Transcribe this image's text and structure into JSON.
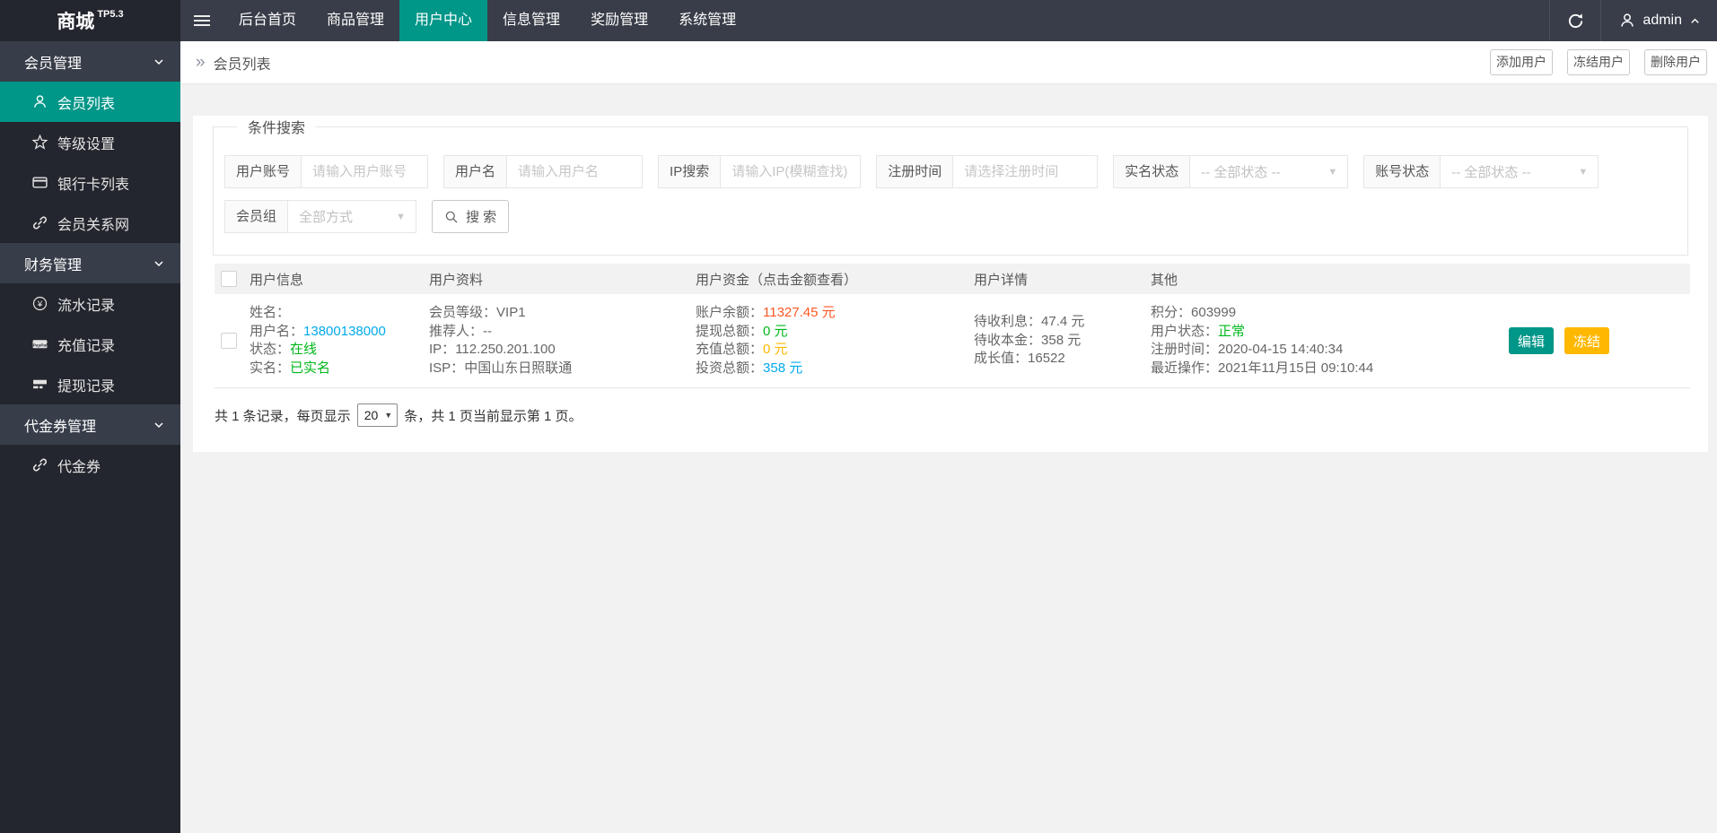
{
  "colors": {
    "accent_teal": "#009688",
    "topbar_bg": "#393d49",
    "logo_bg": "#23262e",
    "sidebar_bg": "#23262e",
    "section_header_bg": "#373d49",
    "red": "#ff5722",
    "green": "#00b81a",
    "blue": "#01aaed",
    "orange": "#ffb800"
  },
  "icons": {
    "breadcrumb_chevrons": "»",
    "select_arrow": "▼",
    "yen": "¥",
    "paypal_text": "PayPal"
  },
  "topbar": {
    "logo": "商城",
    "version": "TP5.3",
    "username": "admin",
    "nav": [
      {
        "label": "后台首页",
        "active": false
      },
      {
        "label": "商品管理",
        "active": false
      },
      {
        "label": "用户中心",
        "active": true
      },
      {
        "label": "信息管理",
        "active": false
      },
      {
        "label": "奖励管理",
        "active": false
      },
      {
        "label": "系统管理",
        "active": false
      }
    ]
  },
  "sidebar": {
    "sections": [
      {
        "title": "会员管理",
        "items": [
          {
            "label": "会员列表",
            "icon": "user-icon",
            "active": true
          },
          {
            "label": "等级设置",
            "icon": "star-icon",
            "active": false
          },
          {
            "label": "银行卡列表",
            "icon": "bank-card-icon",
            "active": false
          },
          {
            "label": "会员关系网",
            "icon": "link-icon",
            "active": false
          }
        ]
      },
      {
        "title": "财务管理",
        "items": [
          {
            "label": "流水记录",
            "icon": "yen-circle-icon",
            "active": false
          },
          {
            "label": "充值记录",
            "icon": "paypal-icon",
            "active": false
          },
          {
            "label": "提现记录",
            "icon": "withdraw-card-icon",
            "active": false
          }
        ]
      },
      {
        "title": "代金券管理",
        "items": [
          {
            "label": "代金券",
            "icon": "link-icon",
            "active": false
          }
        ]
      }
    ]
  },
  "toolbar": {
    "breadcrumb": "会员列表",
    "actions": [
      "添加用户",
      "冻结用户",
      "删除用户"
    ]
  },
  "search": {
    "legend": "条件搜索",
    "fields": [
      {
        "label": "用户账号",
        "placeholder": "请输入用户账号"
      },
      {
        "label": "用户名",
        "placeholder": "请输入用户名"
      },
      {
        "label": "IP搜索",
        "placeholder": "请输入IP(模糊查找)"
      },
      {
        "label": "注册时间",
        "placeholder": "请选择注册时间"
      },
      {
        "label": "实名状态",
        "value": "-- 全部状态 --"
      },
      {
        "label": "账号状态",
        "value": "-- 全部状态 --"
      }
    ],
    "member_group": {
      "label": "会员组",
      "value": "全部方式"
    },
    "button": "搜 索"
  },
  "table": {
    "headers": [
      "用户信息",
      "用户资料",
      "用户资金（点击金额查看）",
      "用户详情",
      "其他"
    ],
    "row": {
      "info": [
        {
          "label": "姓名：",
          "value": ""
        },
        {
          "label": "用户名：",
          "value": "13800138000"
        },
        {
          "label": "状态：",
          "value": "在线"
        },
        {
          "label": "实名：",
          "value": "已实名"
        }
      ],
      "profile": [
        {
          "label": "会员等级：",
          "value": "VIP1"
        },
        {
          "label": "推荐人：",
          "value": "--"
        },
        {
          "label": "IP：",
          "value": "112.250.201.100"
        },
        {
          "label": "ISP：",
          "value": "中国山东日照联通"
        }
      ],
      "funds": [
        {
          "label": "账户余额：",
          "value": "11327.45 元"
        },
        {
          "label": "提现总额：",
          "value": "0 元"
        },
        {
          "label": "充值总额：",
          "value": "0 元"
        },
        {
          "label": "投资总额：",
          "value": "358 元"
        }
      ],
      "details": [
        {
          "label": "待收利息：",
          "value": "47.4 元"
        },
        {
          "label": "待收本金：",
          "value": "358 元"
        },
        {
          "label": "成长值：",
          "value": "16522"
        }
      ],
      "other": [
        {
          "label": "积分：",
          "value": "603999"
        },
        {
          "label": "用户状态：",
          "value": "正常"
        },
        {
          "label": "注册时间：",
          "value": "2020-04-15 14:40:34"
        },
        {
          "label": "最近操作：",
          "value": "2021年11月15日 09:10:44"
        }
      ],
      "actions": [
        "编辑",
        "冻结"
      ]
    }
  },
  "pagination": {
    "prefix": "共 1 条记录，每页显示",
    "page_size": "20",
    "suffix": "条，共 1 页当前显示第 1 页。"
  }
}
